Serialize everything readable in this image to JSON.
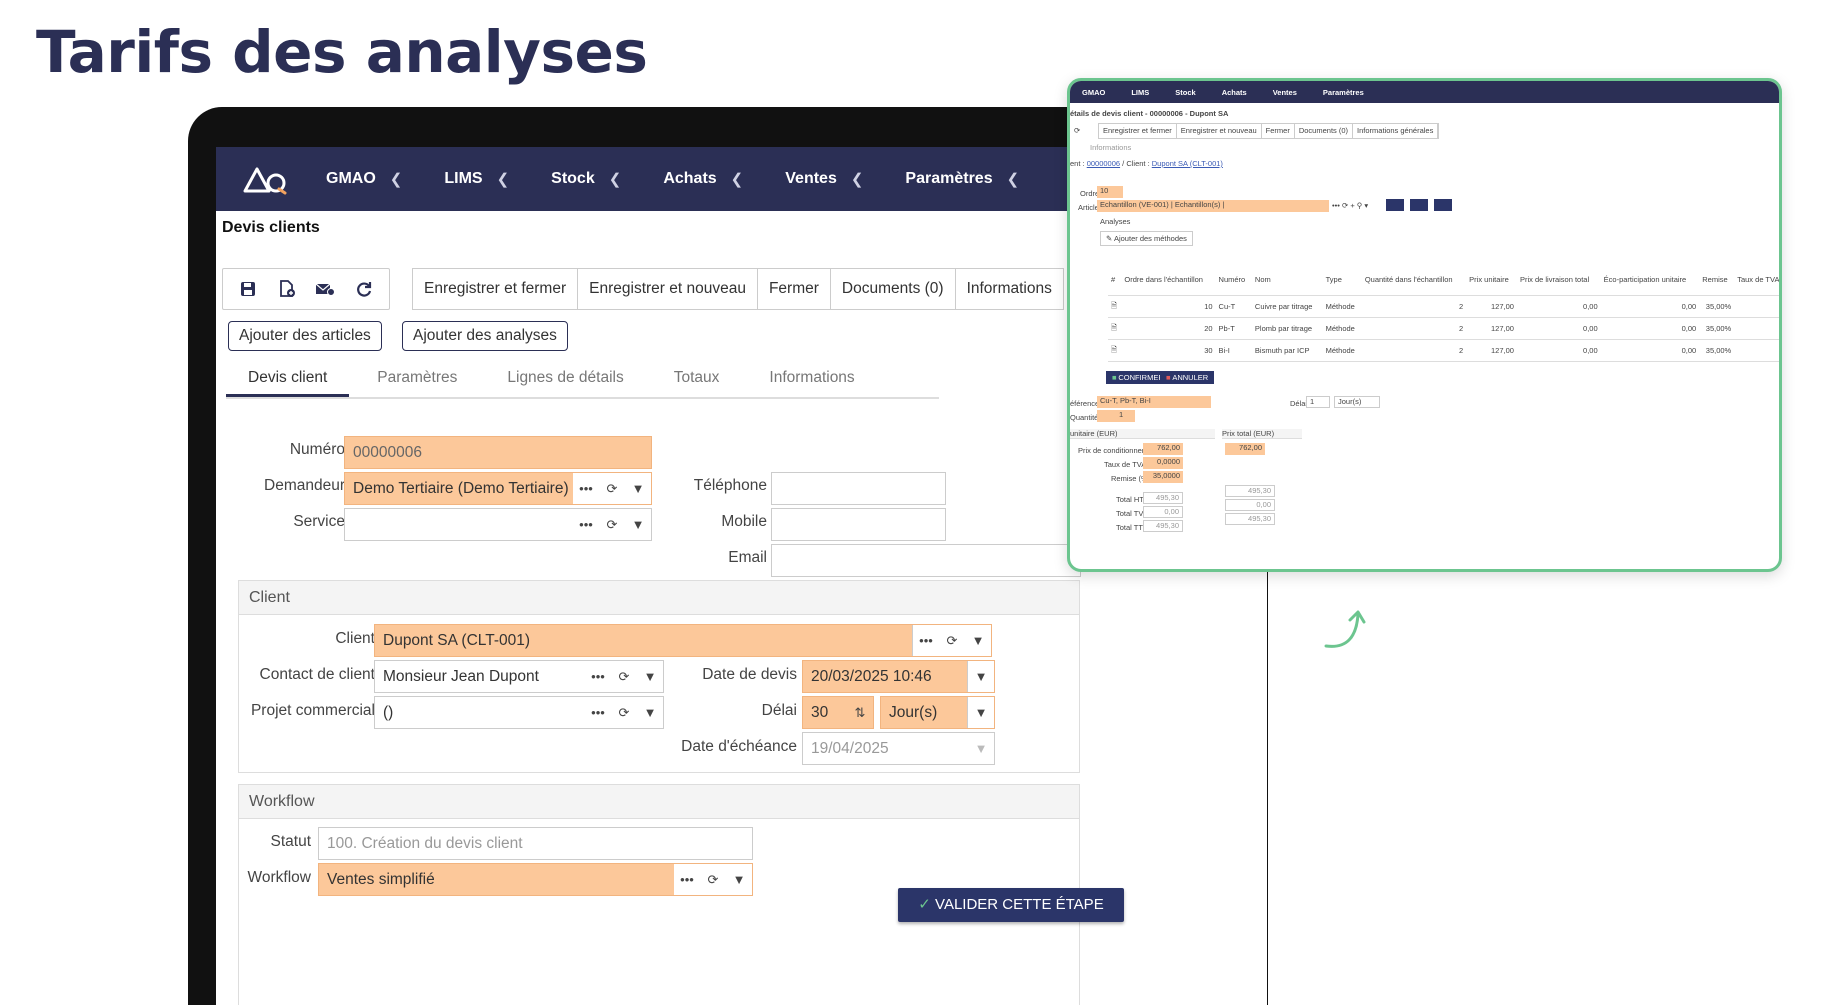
{
  "headline": "Tarifs des analyses",
  "nav": {
    "items": [
      "GMAO",
      "LIMS",
      "Stock",
      "Achats",
      "Ventes",
      "Paramètres"
    ]
  },
  "page_title": "Devis clients",
  "toolbar": {
    "icons": [
      "save-icon",
      "new-document-icon",
      "email-icon",
      "refresh-icon"
    ],
    "buttons": [
      "Enregistrer et fermer",
      "Enregistrer et nouveau",
      "Fermer",
      "Documents (0)",
      "Informations"
    ]
  },
  "actions": {
    "add_articles": "Ajouter des articles",
    "add_analyses": "Ajouter des analyses"
  },
  "tabs": [
    "Devis client",
    "Paramètres",
    "Lignes de détails",
    "Totaux",
    "Informations"
  ],
  "form": {
    "numero_label": "Numéro",
    "numero": "00000006",
    "demandeur_label": "Demandeur",
    "demandeur": "Demo Tertiaire (Demo Tertiaire)",
    "service_label": "Service",
    "service": "",
    "telephone_label": "Téléphone",
    "mobile_label": "Mobile",
    "email_label": "Email"
  },
  "client_section": {
    "title": "Client",
    "client_label": "Client",
    "client": "Dupont SA (CLT-001)",
    "contact_label": "Contact de client",
    "contact": "Monsieur Jean Dupont",
    "projet_label": "Projet commercial",
    "projet": "()",
    "date_devis_label": "Date de devis",
    "date_devis": "20/03/2025 10:46",
    "delai_label": "Délai",
    "delai": "30",
    "delai_unit": "Jour(s)",
    "echeance_label": "Date d'échéance",
    "echeance": "19/04/2025"
  },
  "workflow_section": {
    "title": "Workflow",
    "statut_label": "Statut",
    "statut": "100. Création du devis client",
    "workflow_label": "Workflow",
    "workflow": "Ventes simplifié",
    "validate_button": "VALIDER CETTE ÉTAPE"
  },
  "inset": {
    "nav": [
      "GMAO",
      "LIMS",
      "Stock",
      "Achats",
      "Ventes",
      "Paramètres"
    ],
    "title": "étails de devis client - 00000006 - Dupont SA",
    "buttons": [
      "Enregistrer et fermer",
      "Enregistrer et nouveau",
      "Fermer",
      "Documents (0)",
      "Informations générales"
    ],
    "tab": "Informations",
    "breadcrumb_prefix": "ent :",
    "breadcrumb_devis": "00000006",
    "breadcrumb_client_label": " / Client :",
    "breadcrumb_client": "Dupont SA (CLT-001)",
    "ordre_label": "Ordre",
    "ordre": "10",
    "article_label": "Article",
    "article": "Echantillon (VE-001) | Echantillon(s) |",
    "analyses_label": "Analyses",
    "add_methods": "Ajouter des méthodes",
    "table_headers": [
      "#",
      "Ordre dans l'échantillon",
      "Numéro",
      "Nom",
      "Type",
      "Quantité dans l'échantillon",
      "Prix unitaire",
      "Prix de livraison total",
      "Éco-participation unitaire",
      "Remise",
      "Taux de TVA"
    ],
    "rows": [
      [
        "10",
        "Cu-T",
        "Cuivre par titrage",
        "Méthode",
        "2",
        "127,00",
        "0,00",
        "0,00",
        "35,00%"
      ],
      [
        "20",
        "Pb-T",
        "Plomb par titrage",
        "Méthode",
        "2",
        "127,00",
        "0,00",
        "0,00",
        "35,00%"
      ],
      [
        "30",
        "Bi-I",
        "Bismuth par ICP",
        "Méthode",
        "2",
        "127,00",
        "0,00",
        "0,00",
        "35,00%"
      ]
    ],
    "confirm": "CONFIRMER",
    "cancel": "ANNULER",
    "reference_label": "éférence",
    "reference": "Cu-T, Pb-T, Bi-I",
    "delai_label": "Délai",
    "delai": "1",
    "delai_unit": "Jour(s)",
    "quantite_label": "Quantité",
    "quantite": "1",
    "unit_price_header": "unitaire (EUR)",
    "total_price_header": "Prix total (EUR)",
    "prix_cond_label": "Prix de conditionnement",
    "prix_cond": "762,00",
    "tva_label": "Taux de TVA (%)",
    "tva": "0,0000",
    "remise_label": "Remise (%)",
    "remise": "35,0000",
    "total_price": "762,00",
    "totals": [
      {
        "label": "Total HT",
        "value": "495,30",
        "total": "495,30"
      },
      {
        "label": "Total TVA",
        "value": "0,00",
        "total": "0,00"
      },
      {
        "label": "Total TTC",
        "value": "495,30",
        "total": "495,30"
      }
    ]
  }
}
